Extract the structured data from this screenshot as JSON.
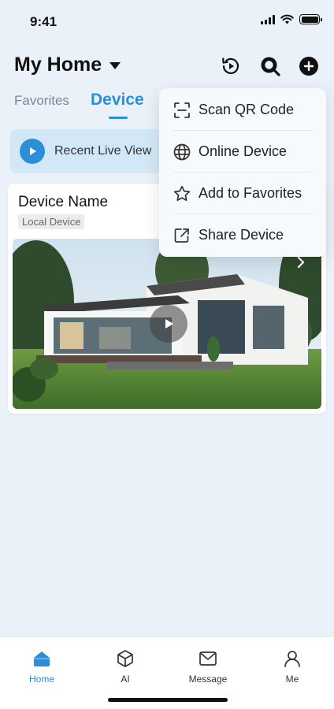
{
  "status": {
    "time": "9:41"
  },
  "header": {
    "title": "My Home"
  },
  "tabs": [
    {
      "label": "Favorites",
      "active": false
    },
    {
      "label": "Device",
      "active": true
    }
  ],
  "live_banner": {
    "label": "Recent Live View"
  },
  "device_card": {
    "name": "Device Name",
    "badge": "Local Device"
  },
  "menu": {
    "items": [
      {
        "label": "Scan QR Code",
        "icon": "scan-qr-icon"
      },
      {
        "label": "Online Device",
        "icon": "globe-icon"
      },
      {
        "label": "Add to Favorites",
        "icon": "star-icon"
      },
      {
        "label": "Share Device",
        "icon": "share-icon"
      }
    ]
  },
  "bottom_nav": {
    "items": [
      {
        "label": "Home",
        "icon": "home-icon",
        "active": true
      },
      {
        "label": "AI",
        "icon": "cube-icon",
        "active": false
      },
      {
        "label": "Message",
        "icon": "message-icon",
        "active": false
      },
      {
        "label": "Me",
        "icon": "person-icon",
        "active": false
      }
    ]
  },
  "colors": {
    "accent": "#2a8fd8",
    "background": "#eaf1f8",
    "banner": "#d3e8f7"
  }
}
